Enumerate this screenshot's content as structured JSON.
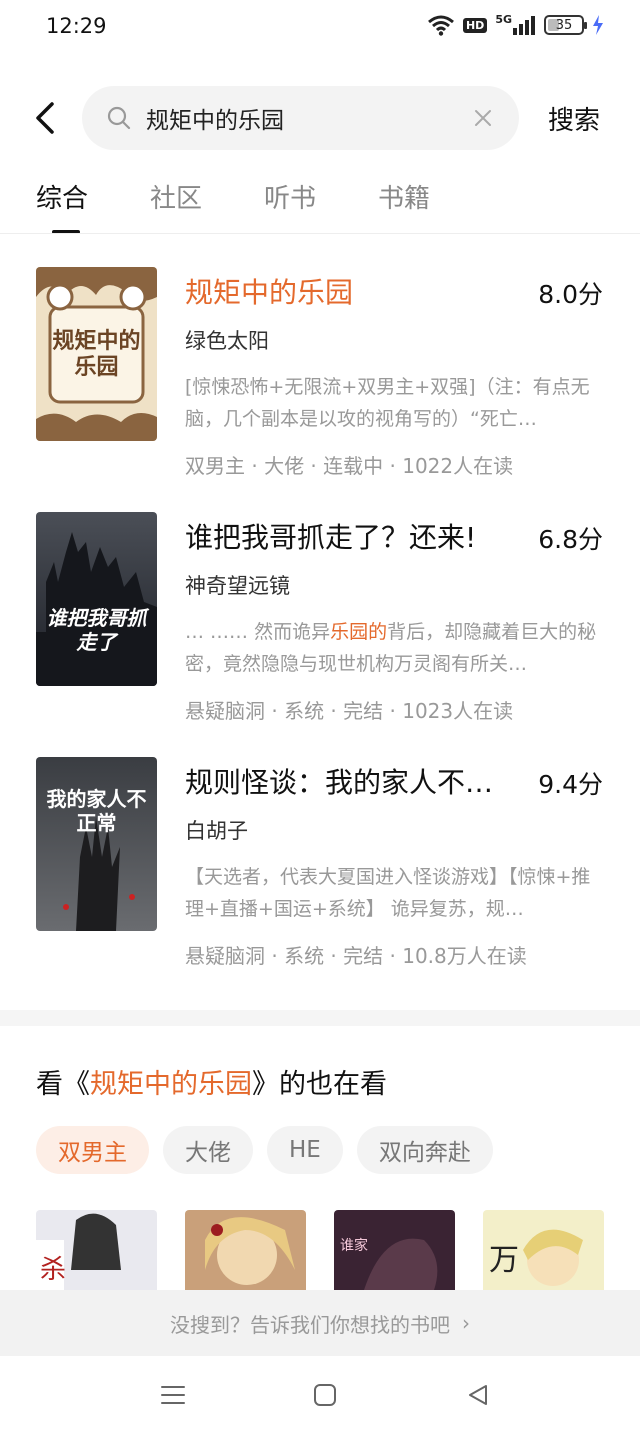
{
  "status": {
    "time": "12:29",
    "network": "5G",
    "hd": "HD",
    "battery": "35",
    "battery_level": 0.35
  },
  "search": {
    "query": "规矩中的乐园",
    "button_label": "搜索"
  },
  "tabs": [
    {
      "label": "综合",
      "active": true
    },
    {
      "label": "社区",
      "active": false
    },
    {
      "label": "听书",
      "active": false
    },
    {
      "label": "书籍",
      "active": false
    }
  ],
  "results": [
    {
      "title": "规矩中的乐园",
      "score": "8.0分",
      "author": "绿色太阳",
      "desc": "[惊悚恐怖+无限流+双男主+双强]（注：有点无脑，几个副本是以攻的视角写的）“死亡…",
      "meta": "双男主 · 大佬 · 连载中 · 1022人在读",
      "cover_text": "规矩中的乐园"
    },
    {
      "title": "谁把我哥抓走了？还来!",
      "score": "6.8分",
      "author": "神奇望远镜",
      "desc_pre": "… …… 然而诡异",
      "desc_hl": "乐园的",
      "desc_post": "背后，却隐藏着巨大的秘密，竟然隐隐与现世机构万灵阁有所关…",
      "meta": "悬疑脑洞 · 系统 · 完结 · 1023人在读",
      "cover_text": "谁把我哥抓走了"
    },
    {
      "title": "规则怪谈：我的家人不…",
      "score": "9.4分",
      "author": "白胡子",
      "desc": "【天选者，代表大夏国进入怪谈游戏】【惊悚+推理+直播+国运+系统】 诡异复苏，规…",
      "meta": "悬疑脑洞 · 系统 · 完结 · 10.8万人在读",
      "cover_text": "我的家人不正常"
    }
  ],
  "also_watching": {
    "prefix": "看《",
    "book": "规矩中的乐园",
    "suffix": "》的也在看"
  },
  "chips": [
    {
      "label": "双男主",
      "active": true
    },
    {
      "label": "大佬",
      "active": false
    },
    {
      "label": "HE",
      "active": false
    },
    {
      "label": "双向奔赴",
      "active": false
    }
  ],
  "feedback": {
    "text": "没搜到？告诉我们你想找的书吧",
    "arrow": "›"
  },
  "colors": {
    "accent": "#e4692c",
    "chip_active_bg": "#fdeee6"
  },
  "icons": [
    "back-icon",
    "search-icon",
    "clear-icon",
    "menu-icon",
    "home-icon",
    "back-nav-icon"
  ]
}
